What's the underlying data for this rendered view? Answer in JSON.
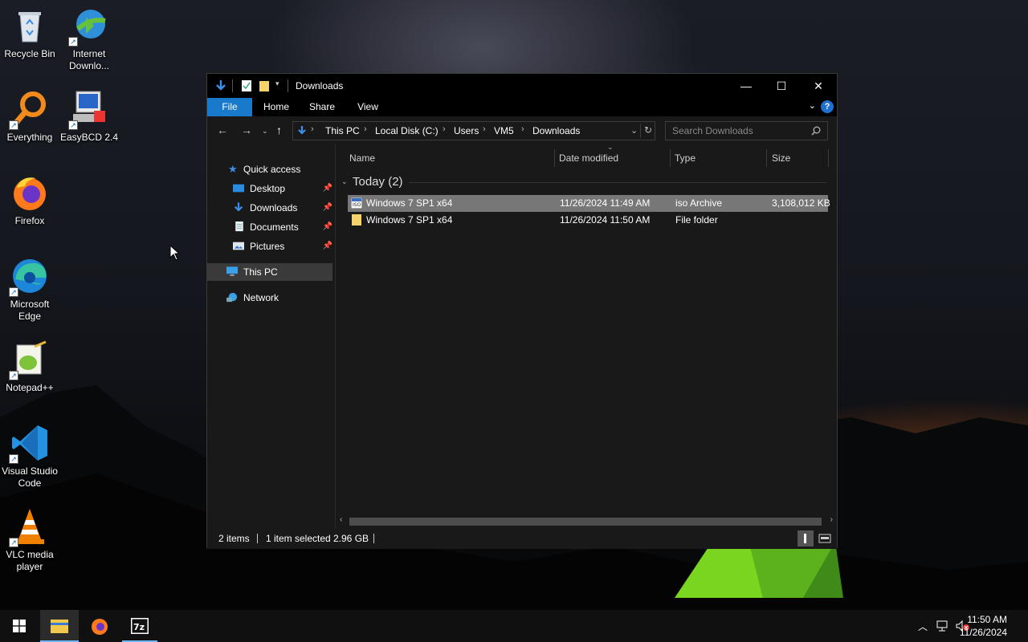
{
  "desktop": {
    "icons": [
      {
        "label": "Recycle Bin",
        "icon": "recycle-bin-icon"
      },
      {
        "label": "Internet Downlo...",
        "icon": "internet-download-manager-icon"
      },
      {
        "label": "Everything",
        "icon": "everything-search-icon"
      },
      {
        "label": "EasyBCD 2.4",
        "icon": "easybcd-icon"
      },
      {
        "label": "Firefox",
        "icon": "firefox-icon"
      },
      {
        "label": "Microsoft Edge",
        "icon": "edge-icon"
      },
      {
        "label": "Notepad++",
        "icon": "notepadpp-icon"
      },
      {
        "label": "Visual Studio Code",
        "icon": "vscode-icon"
      },
      {
        "label": "VLC media player",
        "icon": "vlc-icon"
      }
    ]
  },
  "window": {
    "title": "Downloads",
    "ribbon_tabs": [
      "File",
      "Home",
      "Share",
      "View"
    ],
    "help_label": "?",
    "controls": {
      "minimize": "—",
      "maximize": "☐",
      "close": "✕"
    }
  },
  "address": {
    "crumbs": [
      "This PC",
      "Local Disk (C:)",
      "Users",
      "VM5",
      "Downloads"
    ],
    "search_placeholder": "Search Downloads"
  },
  "nav_pane": {
    "quick_access": "Quick access",
    "pinned": [
      {
        "label": "Desktop",
        "icon": "desktop-folder-icon"
      },
      {
        "label": "Downloads",
        "icon": "downloads-folder-icon"
      },
      {
        "label": "Documents",
        "icon": "documents-folder-icon"
      },
      {
        "label": "Pictures",
        "icon": "pictures-folder-icon"
      }
    ],
    "this_pc": "This PC",
    "network": "Network"
  },
  "file_list": {
    "columns": [
      "Name",
      "Date modified",
      "Type",
      "Size"
    ],
    "group_label": "Today (2)",
    "rows": [
      {
        "name": "Windows 7 SP1 x64",
        "date": "11/26/2024 11:49 AM",
        "type": "iso Archive",
        "size": "3,108,012 KB",
        "icon": "iso-archive-icon",
        "selected": true
      },
      {
        "name": "Windows 7 SP1 x64",
        "date": "11/26/2024 11:50 AM",
        "type": "File folder",
        "size": "",
        "icon": "folder-icon",
        "selected": false
      }
    ]
  },
  "status_bar": {
    "item_count": "2 items",
    "selection": "1 item selected",
    "selection_size": "2.96 GB"
  },
  "taskbar": {
    "apps": [
      "start-button",
      "file-explorer",
      "firefox",
      "7-zip"
    ],
    "time": "11:50 AM",
    "date": "11/26/2024"
  },
  "colors": {
    "accent": "#1979ca",
    "selection": "#777777",
    "window_bg": "#191919"
  }
}
